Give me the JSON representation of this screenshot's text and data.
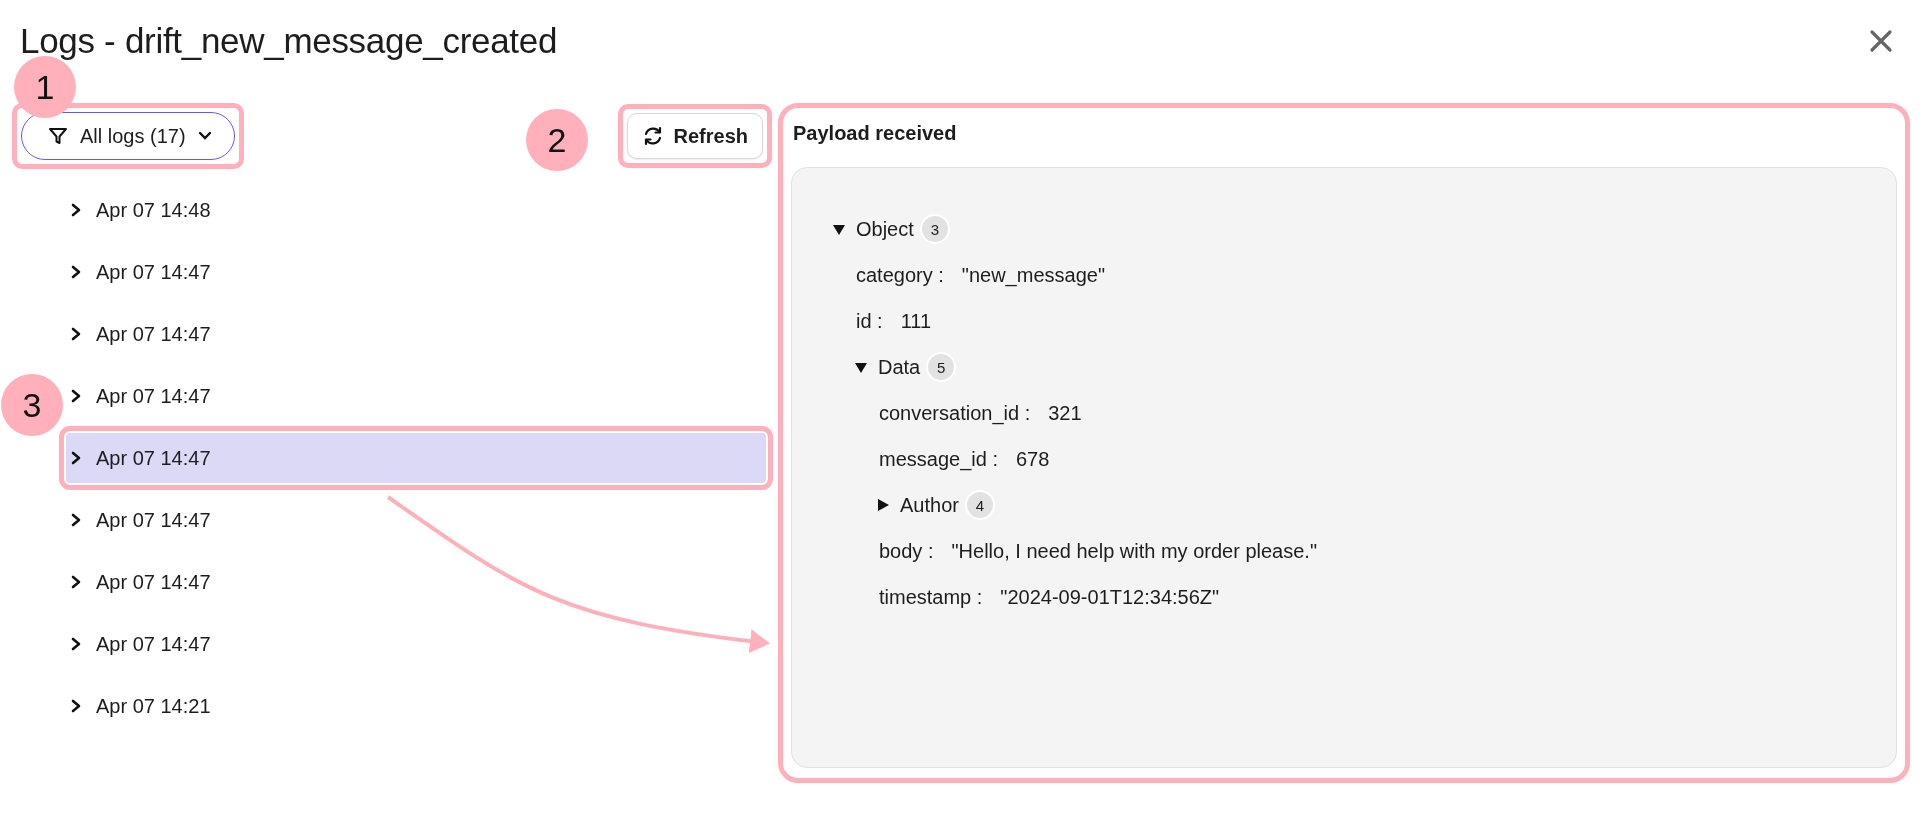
{
  "title": "Logs - drift_new_message_created",
  "annotations": [
    {
      "number": "1"
    },
    {
      "number": "2"
    },
    {
      "number": "3"
    }
  ],
  "filter": {
    "label": "All logs (17)",
    "framed": true
  },
  "refresh": {
    "label": "Refresh",
    "framed": true
  },
  "logs": [
    {
      "time": "Apr 07 14:48",
      "selected": false,
      "framed": false
    },
    {
      "time": "Apr 07 14:47",
      "selected": false,
      "framed": false
    },
    {
      "time": "Apr 07 14:47",
      "selected": false,
      "framed": false
    },
    {
      "time": "Apr 07 14:47",
      "selected": false,
      "framed": false
    },
    {
      "time": "Apr 07 14:47",
      "selected": true,
      "framed": true
    },
    {
      "time": "Apr 07 14:47",
      "selected": false,
      "framed": false
    },
    {
      "time": "Apr 07 14:47",
      "selected": false,
      "framed": false
    },
    {
      "time": "Apr 07 14:47",
      "selected": false,
      "framed": false
    },
    {
      "time": "Apr 07 14:21",
      "selected": false,
      "framed": false
    }
  ],
  "payload": {
    "title": "Payload received",
    "framed": true,
    "tree": [
      {
        "kind": "object",
        "label": "Object",
        "count": "3",
        "expanded": true,
        "children": [
          {
            "kind": "field",
            "key": "category :",
            "value": "\"new_message\""
          },
          {
            "kind": "field",
            "key": "id :",
            "value": "111"
          },
          {
            "kind": "object",
            "label": "Data",
            "count": "5",
            "expanded": true,
            "children": [
              {
                "kind": "field",
                "key": "conversation_id :",
                "value": "321"
              },
              {
                "kind": "field",
                "key": "message_id :",
                "value": "678"
              },
              {
                "kind": "object",
                "label": "Author",
                "count": "4",
                "expanded": false
              },
              {
                "kind": "field",
                "key": "body :",
                "value": "\"Hello, I need help with my order please.\""
              },
              {
                "kind": "field",
                "key": "timestamp :",
                "value": "\"2024-09-01T12:34:56Z\""
              }
            ]
          }
        ]
      }
    ]
  }
}
